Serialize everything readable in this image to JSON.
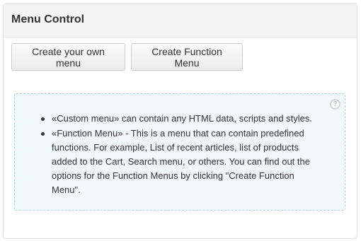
{
  "panel": {
    "title": "Menu Control"
  },
  "buttons": {
    "create_own_label": "Create your own menu",
    "create_function_label": "Create Function Menu"
  },
  "info": {
    "help_icon": "question-circle-icon",
    "help_glyph": "?",
    "items": [
      "«Custom menu» can contain any HTML data, scripts and styles.",
      "«Function Menu» - This is a menu that can contain predefined functions. For example, List of recent articles, list of products added to the Cart, Search menu, or others. You can find out the options for the Function Menus by clicking \"Create Function Menu\"."
    ]
  }
}
